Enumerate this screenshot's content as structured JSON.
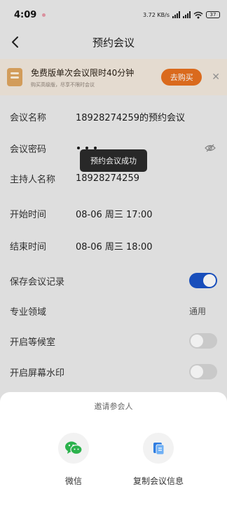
{
  "status_bar": {
    "time": "4:09",
    "net_speed": "3.72 KB/s",
    "battery": "37"
  },
  "nav": {
    "title": "预约会议",
    "back_icon": "chevron-left-icon"
  },
  "promo": {
    "title": "免费版单次会议限时40分钟",
    "subtitle": "购买高级版，尽享不限时会议",
    "button_label": "去购买",
    "close_label": "✕"
  },
  "form": {
    "meeting_name_label": "会议名称",
    "meeting_name_value": "18928274259的预约会议",
    "password_label": "会议密码",
    "host_label": "主持人名称",
    "host_value": "18928274259",
    "start_label": "开始时间",
    "start_value": "08-06 周三 17:00",
    "end_label": "结束时间",
    "end_value": "08-06 周三 18:00",
    "save_record_label": "保存会议记录",
    "save_record_on": true,
    "domain_label": "专业领域",
    "domain_value": "通用",
    "waiting_room_label": "开启等候室",
    "waiting_room_on": false,
    "watermark_label": "开启屏幕水印",
    "watermark_on": false
  },
  "toast": {
    "text": "预约会议成功"
  },
  "sheet": {
    "title": "邀请参会人",
    "options": [
      {
        "label": "微信",
        "icon": "wechat-icon"
      },
      {
        "label": "复制会议信息",
        "icon": "copy-icon"
      }
    ]
  },
  "colors": {
    "accent": "#1a53c7",
    "promo_button": "#e8711f",
    "wechat_green": "#2bb24c"
  }
}
